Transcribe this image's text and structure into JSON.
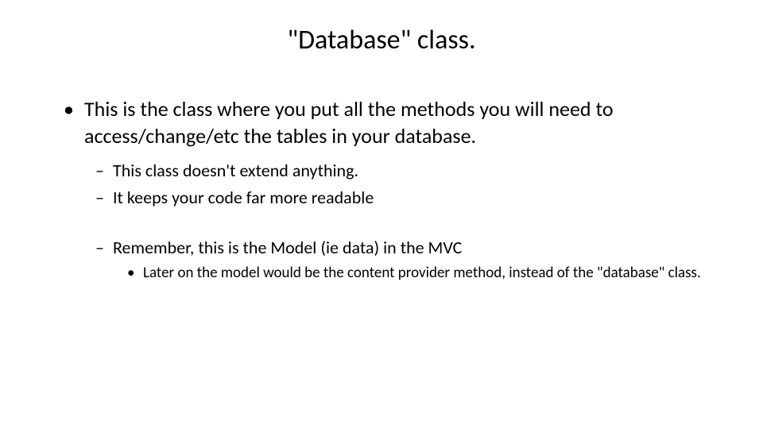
{
  "slide": {
    "title": "\"Database\" class.",
    "bullet1": "This is the class where you put all the methods you will need to access/change/etc the tables in your database.",
    "sub1": "This class doesn't extend anything.",
    "sub2": "It keeps your code far more readable",
    "sub3": "Remember, this is the Model (ie data) in the MVC",
    "subsub1": "Later on the model would be the content provider method, instead of the \"database\" class."
  }
}
